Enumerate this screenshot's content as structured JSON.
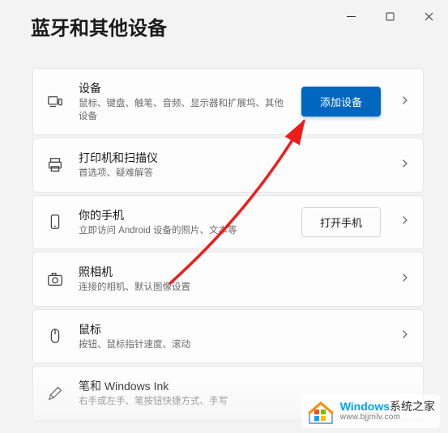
{
  "window": {
    "title": "蓝牙和其他设备"
  },
  "cards": [
    {
      "title": "设备",
      "subtitle": "鼠标、键盘、触笔、音频、显示器和扩展坞、其他设备",
      "button": "添加设备",
      "button_style": "primary"
    },
    {
      "title": "打印机和扫描仪",
      "subtitle": "首选项、疑难解答"
    },
    {
      "title": "你的手机",
      "subtitle": "立即访问 Android 设备的照片、文本等",
      "button": "打开手机",
      "button_style": "default"
    },
    {
      "title": "照相机",
      "subtitle": "连接的相机、默认图像设置"
    },
    {
      "title": "鼠标",
      "subtitle": "按钮、鼠标指针速度、滚动"
    },
    {
      "title": "笔和 Windows Ink",
      "subtitle": "右手或左手、笔按钮快捷方式、手写"
    }
  ],
  "watermark": {
    "brand_prefix": "Windows",
    "brand_suffix": "系统之家",
    "url": "www.bjjmlv.com"
  }
}
